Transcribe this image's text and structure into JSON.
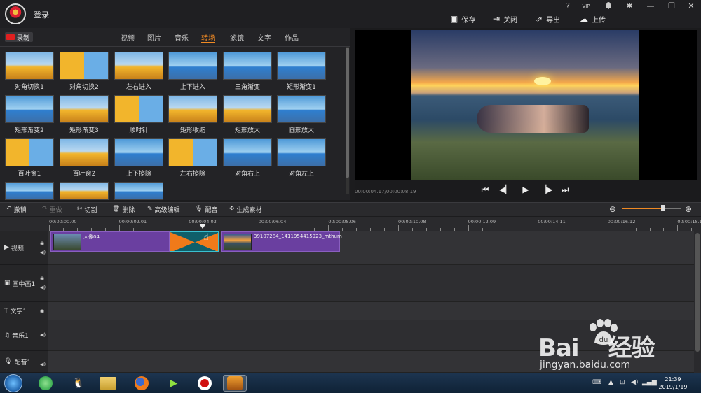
{
  "header": {
    "login_label": "登录",
    "window_controls": [
      "?",
      "VIP",
      "bell-icon",
      "gear-icon",
      "minimize-icon",
      "restore-icon",
      "close-icon"
    ],
    "actions": [
      {
        "icon": "save-icon",
        "label": "保存"
      },
      {
        "icon": "exit-icon",
        "label": "关闭"
      },
      {
        "icon": "export-icon",
        "label": "导出"
      },
      {
        "icon": "upload-icon",
        "label": "上传"
      }
    ]
  },
  "library": {
    "record_label": "录制",
    "tabs": [
      "视频",
      "图片",
      "音乐",
      "转场",
      "滤镜",
      "文字",
      "作品"
    ],
    "active_tab": "转场",
    "transitions": [
      "对角切换1",
      "对角切换2",
      "左右进入",
      "上下进入",
      "三角渐变",
      "矩形渐变1",
      "矩形渐变2",
      "矩形渐变3",
      "顺时针",
      "矩形收缩",
      "矩形放大",
      "圆形放大",
      "百叶窗1",
      "百叶窗2",
      "上下擦除",
      "左右擦除",
      "对角右上",
      "对角左上"
    ]
  },
  "preview": {
    "timecode": "00:00:04.17/00:00:08.19",
    "controls": [
      "skip-start-icon",
      "step-back-icon",
      "play-icon",
      "step-forward-icon",
      "skip-end-icon"
    ]
  },
  "toolbar": {
    "undo": "撤销",
    "redo": "重做",
    "cut": "切割",
    "delete": "删除",
    "advanced_edit": "高级编辑",
    "dub": "配音",
    "generate": "生成素材",
    "zoom_level": 0.7
  },
  "timeline": {
    "ruler": [
      "00:00:00.00",
      "00:00:02.01",
      "00:00:04.03",
      "00:00:06.04",
      "00:00:08.06",
      "00:00:10.08",
      "00:00:12.09",
      "00:00:14.11",
      "00:00:16.12",
      "00:00:18.1"
    ],
    "tracks": [
      {
        "icon": "video-track-icon",
        "label": "视频"
      },
      {
        "icon": "pip-track-icon",
        "label": "画中画1"
      },
      {
        "icon": "text-track-icon",
        "label": "文字1"
      },
      {
        "icon": "music-track-icon",
        "label": "音乐1"
      },
      {
        "icon": "mic-track-icon",
        "label": "配音1"
      }
    ],
    "clips": [
      {
        "name": "人像04"
      },
      {
        "name": "39107284_1411954415923_mthum"
      }
    ]
  },
  "taskbar": {
    "apps": [
      "start-icon",
      "360-browser-icon",
      "qq-icon",
      "file-explorer-icon",
      "firefox-icon",
      "video-editor-icon",
      "recorder-icon",
      "app-icon"
    ],
    "time": "21:39",
    "date": "2019/1/19"
  },
  "watermark": {
    "brand": "Bai",
    "brand_cn": "经验",
    "url": "jingyan.baidu.com"
  }
}
